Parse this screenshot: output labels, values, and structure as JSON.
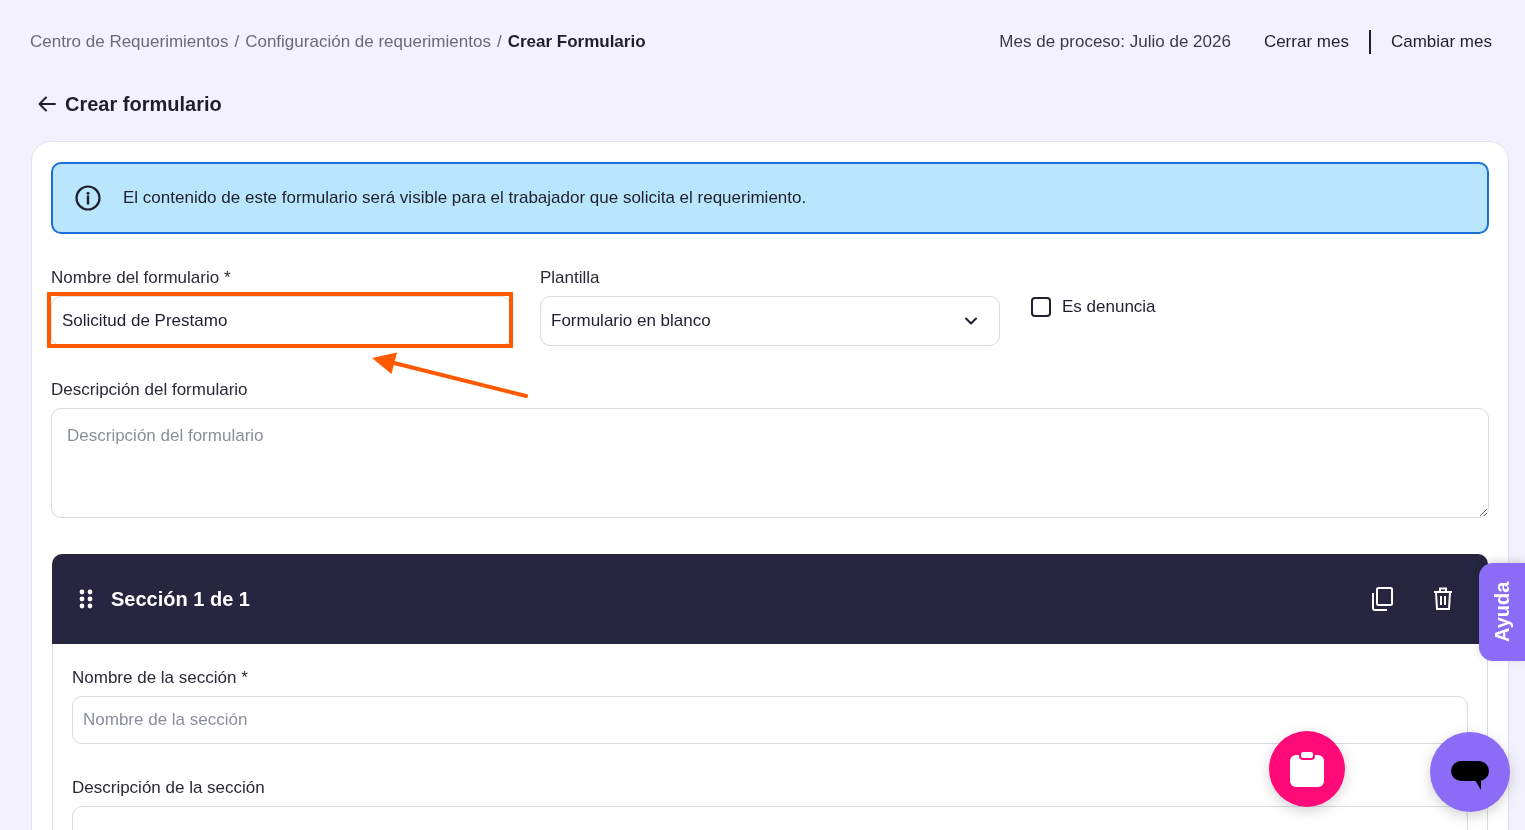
{
  "breadcrumb": {
    "items": [
      {
        "label": "Centro de Requerimientos",
        "current": false
      },
      {
        "label": "Configuración de requerimientos",
        "current": false
      },
      {
        "label": "Crear Formulario",
        "current": true
      }
    ],
    "separators": [
      "/",
      "/"
    ]
  },
  "process_month": "Mes de proceso: Julio de 2026",
  "header_actions": [
    "Cerrar mes",
    "Cambiar mes"
  ],
  "page_title": "Crear formulario",
  "notice": "El contenido de este formulario será visible para el trabajador que solicita el requerimiento.",
  "form": {
    "name_field": {
      "label": "Nombre del formulario *",
      "value": "Solicitud de Prestamo",
      "highlighted": true
    },
    "template_select": {
      "label": "Plantilla",
      "value": "Formulario en blanco"
    },
    "complaint_checkbox": {
      "label": "Es denuncia",
      "checked": false
    },
    "description_field": {
      "label": "Descripción del formulario",
      "placeholder": "Descripción del formulario"
    }
  },
  "sections": [
    {
      "title": "Sección 1 de 1",
      "name_field": {
        "label": "Nombre de la sección *",
        "placeholder": "Nombre de la sección"
      },
      "description_field": {
        "label": "Descripción de la sección"
      }
    }
  ],
  "help_tab": "Ayuda"
}
